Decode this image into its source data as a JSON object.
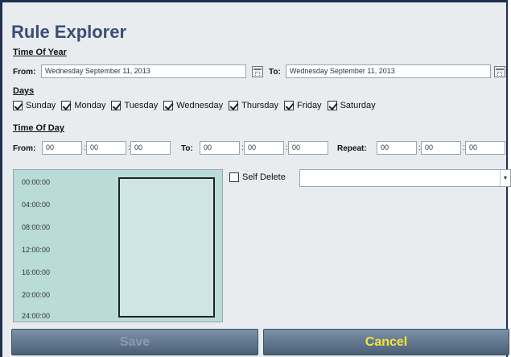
{
  "title": "Rule Explorer",
  "time_of_year": {
    "heading": "Time Of Year",
    "from_label": "From:",
    "from_value": "Wednesday September 11, 2013",
    "to_label": "To:",
    "to_value": "Wednesday September 11, 2013"
  },
  "days": {
    "heading": "Days",
    "items": [
      {
        "label": "Sunday",
        "checked": true
      },
      {
        "label": "Monday",
        "checked": true
      },
      {
        "label": "Tuesday",
        "checked": true
      },
      {
        "label": "Wednesday",
        "checked": true
      },
      {
        "label": "Thursday",
        "checked": true
      },
      {
        "label": "Friday",
        "checked": true
      },
      {
        "label": "Saturday",
        "checked": true
      }
    ]
  },
  "time_of_day": {
    "heading": "Time Of Day",
    "from_label": "From:",
    "from": [
      "00",
      "00",
      "00"
    ],
    "to_label": "To:",
    "to": [
      "00",
      "00",
      "00"
    ],
    "repeat_label": "Repeat:",
    "repeat": [
      "00",
      "00",
      "00"
    ],
    "separator": ":"
  },
  "timeline": {
    "labels": [
      "00:00:00",
      "04:00:00",
      "08:00:00",
      "12:00:00",
      "16:00:00",
      "20:00:00",
      "24:00:00"
    ]
  },
  "self_delete": {
    "label": "Self Delete",
    "checked": false,
    "selected_value": ""
  },
  "buttons": {
    "save": "Save",
    "cancel": "Cancel"
  }
}
